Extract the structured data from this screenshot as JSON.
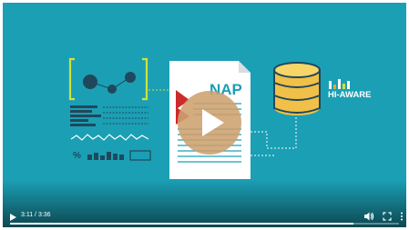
{
  "video": {
    "time_display": "3:11 / 3:36",
    "progress": 0.884
  },
  "overlay": {
    "document_label": "NAP",
    "brand_label": "HI-AWARE",
    "percent_symbol": "%"
  },
  "colors": {
    "background": "#1b9fb4",
    "dark_navy": "#20485c",
    "bracket_green": "#cfe13c",
    "database_gold": "#f0c048",
    "play_button": "#cda06e"
  },
  "icons": {
    "play_control": "play-icon",
    "volume": "volume-icon",
    "fullscreen": "fullscreen-icon",
    "more": "more-vert-icon",
    "big_play": "play-icon"
  }
}
